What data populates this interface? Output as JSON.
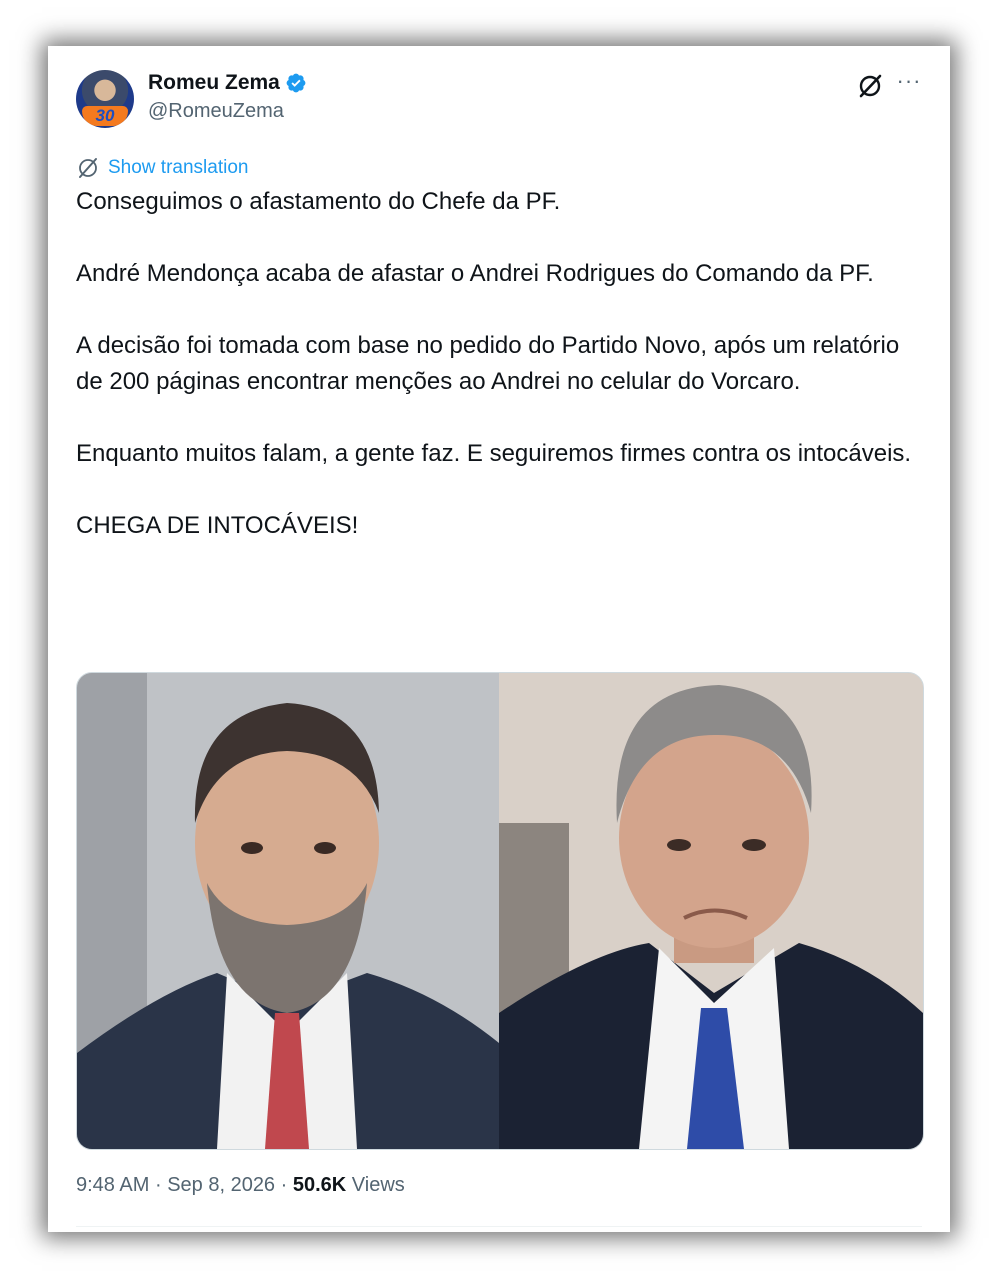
{
  "author": {
    "name": "Romeu Zema",
    "handle": "@RomeuZema",
    "avatar_badge": "30",
    "verified_icon": "verified-badge-icon",
    "verified_color": "#1d9bf0"
  },
  "actions": {
    "grok_icon": "grok-icon",
    "more_label": "···"
  },
  "translation": {
    "icon": "grok-translate-icon",
    "label": "Show translation",
    "color": "#1d9bf0"
  },
  "tweet": {
    "paragraphs": [
      "Conseguimos o afastamento do Chefe da PF.",
      "André Mendonça acaba de afastar o Andrei Rodrigues do Comando da PF.",
      "A decisão foi tomada com base no pedido do Partido Novo, após um relatório de 200 páginas encontrar menções ao Andrei no celular do Vorcaro.",
      "Enquanto muitos falam, a gente faz. E seguiremos firmes contra os intocáveis.",
      "CHEGA DE INTOCÁVEIS!"
    ]
  },
  "media": {
    "photos": [
      "portrait-man-beard-suit-red-tie",
      "portrait-man-grey-hair-robe-blue-tie"
    ]
  },
  "meta": {
    "time": "9:48 AM",
    "separator": "·",
    "date": "Sep 8, 2026",
    "views_count": "50.6K",
    "views_label": "Views"
  },
  "colors": {
    "text_primary": "#0f1419",
    "text_secondary": "#536471",
    "accent": "#1d9bf0"
  }
}
